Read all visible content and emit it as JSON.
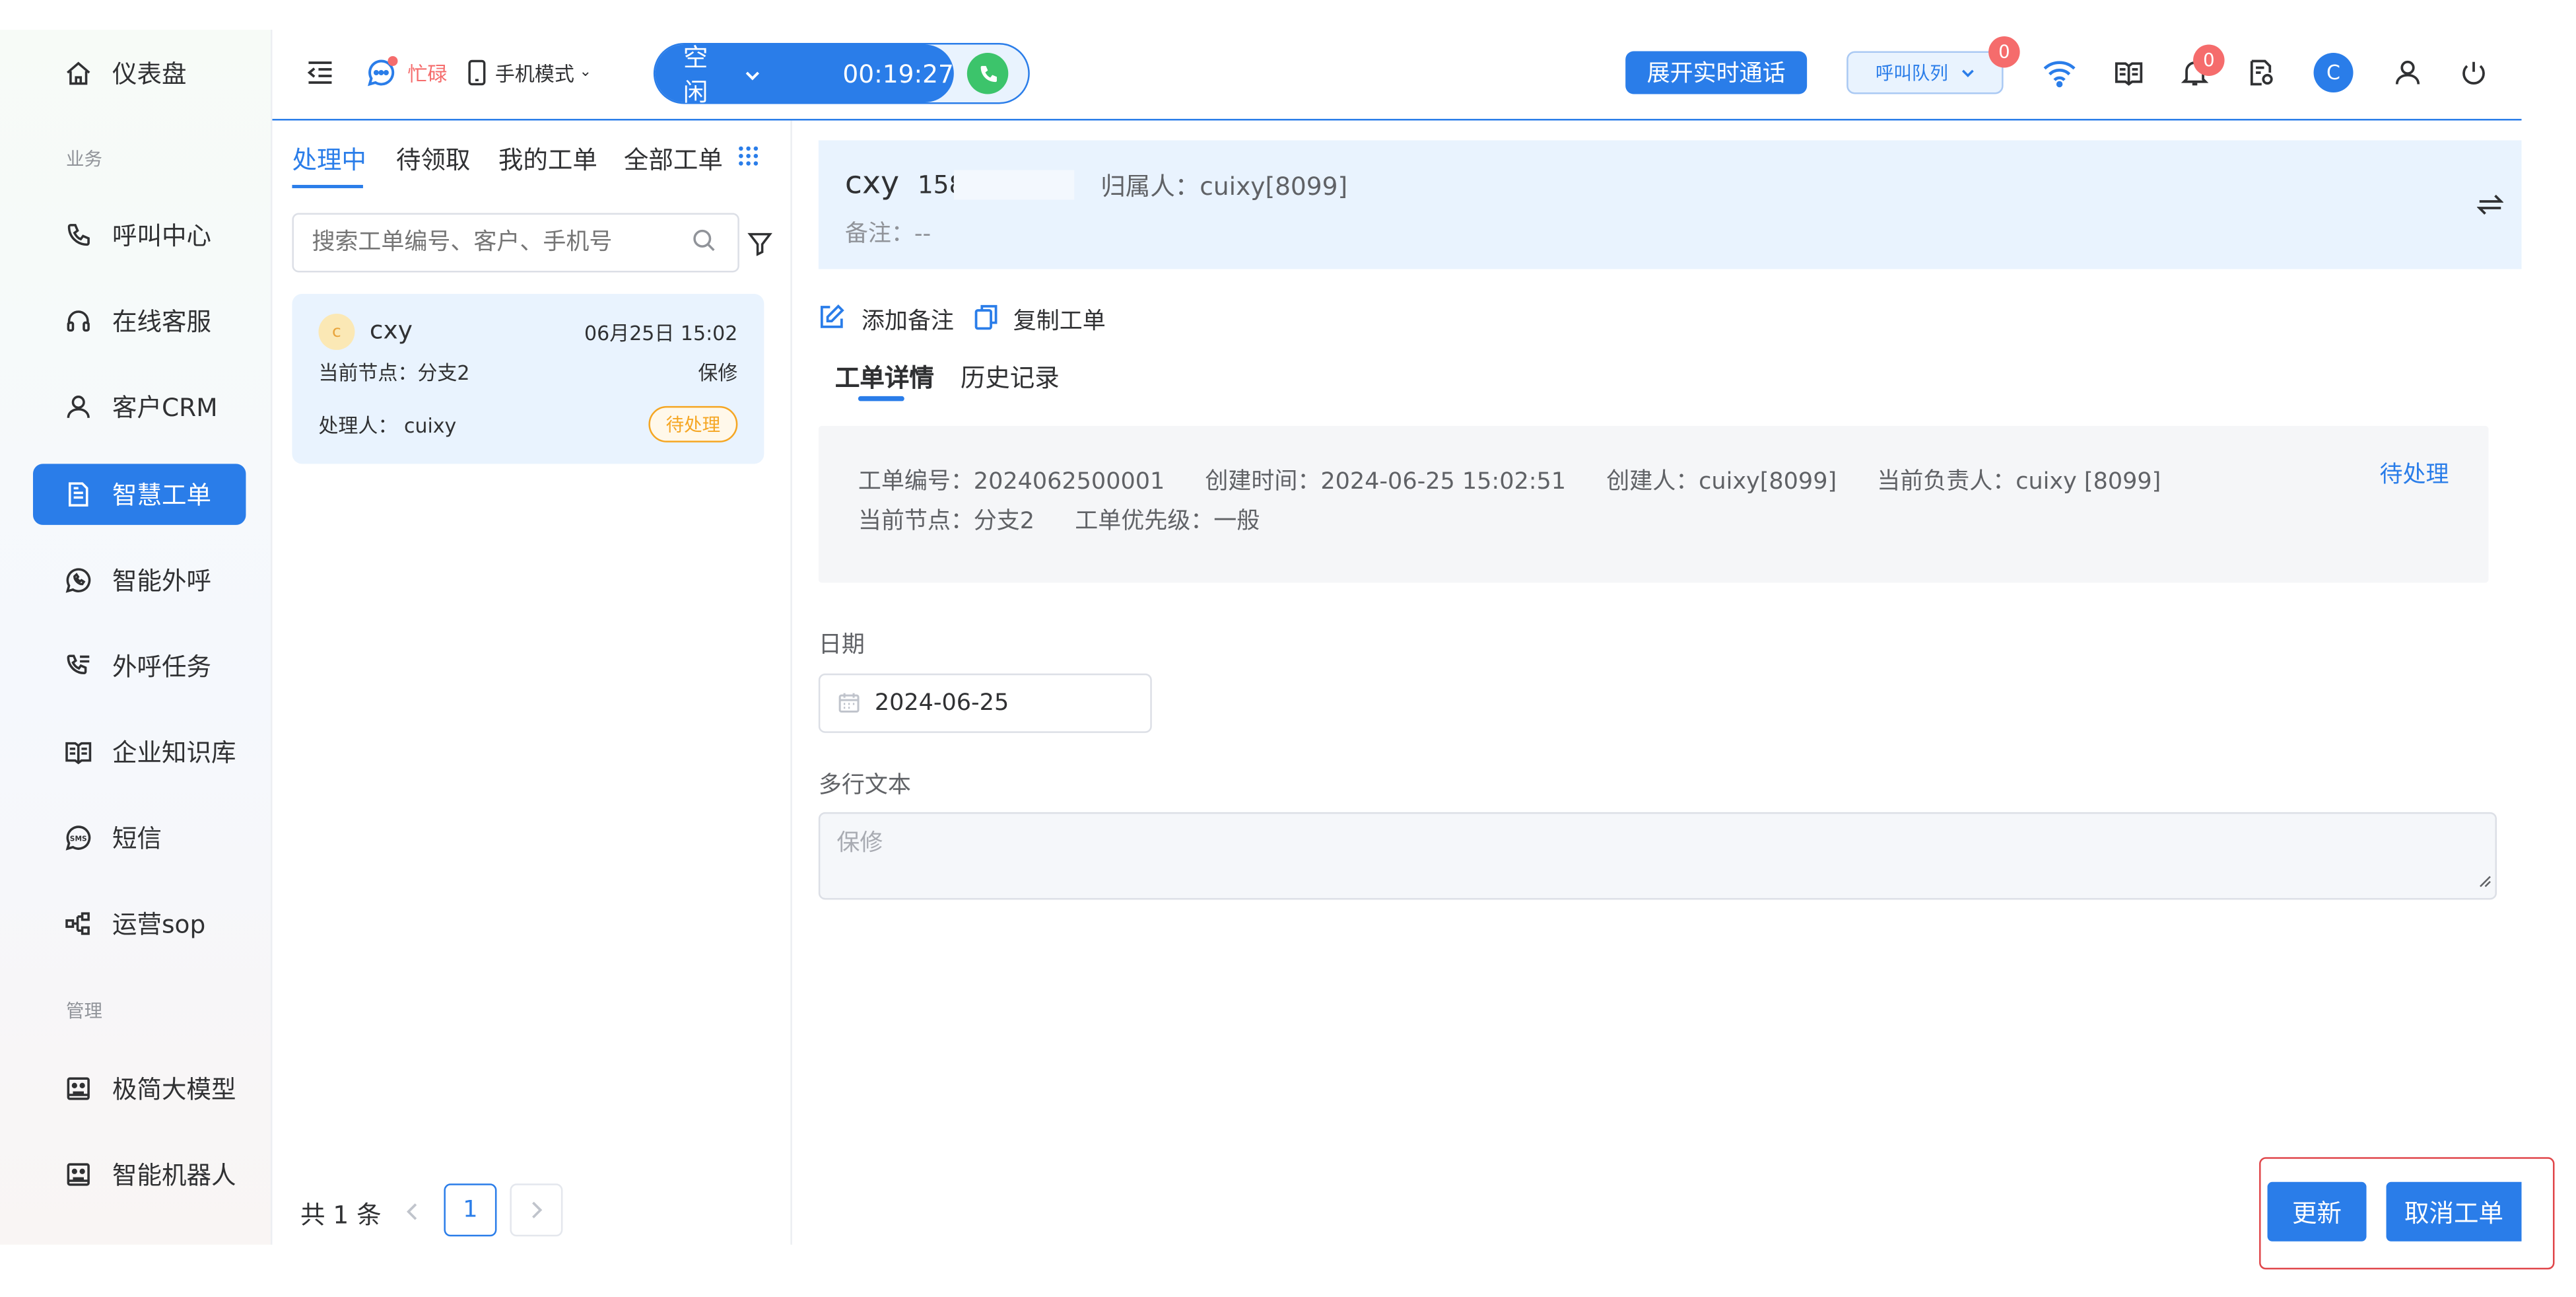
{
  "sidebar": {
    "items": [
      {
        "label": "仪表盘",
        "icon": "home-icon"
      },
      {
        "label": "呼叫中心",
        "icon": "phone-icon"
      },
      {
        "label": "在线客服",
        "icon": "headset-icon"
      },
      {
        "label": "客户CRM",
        "icon": "user-icon"
      },
      {
        "label": "智慧工单",
        "icon": "document-icon",
        "active": true
      },
      {
        "label": "智能外呼",
        "icon": "whatsapp-phone-icon"
      },
      {
        "label": "外呼任务",
        "icon": "phone-list-icon"
      },
      {
        "label": "企业知识库",
        "icon": "book-icon"
      },
      {
        "label": "短信",
        "icon": "sms-icon"
      },
      {
        "label": "运营sop",
        "icon": "flow-icon"
      },
      {
        "label": "极简大模型",
        "icon": "robot-icon"
      },
      {
        "label": "智能机器人",
        "icon": "robot-icon"
      }
    ],
    "sections": {
      "business": "业务",
      "management": "管理"
    }
  },
  "topbar": {
    "busy_label": "忙碌",
    "mode_label": "手机模式",
    "status_label": "空闲",
    "timer": "00:19:27",
    "expand_call_label": "展开实时通话",
    "queue_label": "呼叫队列",
    "queue_badge": "0",
    "notify_badge": "0",
    "avatar_letter": "C"
  },
  "list": {
    "tabs": [
      "处理中",
      "待领取",
      "我的工单",
      "全部工单"
    ],
    "search_placeholder": "搜索工单编号、客户、手机号",
    "card": {
      "avatar": "c",
      "name": "cxy",
      "time": "06月25日 15:02",
      "node": "当前节点：分支2",
      "type": "保修",
      "handler": "处理人： cuixy",
      "status": "待处理"
    },
    "total": "共 1 条",
    "page": "1"
  },
  "detail": {
    "customer_name": "cxy",
    "phone": "158",
    "owner": "归属人：cuixy[8099]",
    "remark": "备注：--",
    "add_remark": "添加备注",
    "copy_order": "复制工单",
    "tabs": [
      "工单详情",
      "历史记录"
    ],
    "info": {
      "order_no": "工单编号：2024062500001",
      "created_time": "创建时间：2024-06-25 15:02:51",
      "creator": "创建人：cuixy[8099]",
      "assignee": "当前负责人：cuixy [8099]",
      "node": "当前节点：分支2",
      "priority": "工单优先级：一般",
      "status": "待处理"
    },
    "date_label": "日期",
    "date_value": "2024-06-25",
    "text_label": "多行文本",
    "text_value": "保修",
    "update_label": "更新",
    "cancel_label": "取消工单"
  },
  "colors": {
    "accent": "#2a7de9",
    "highlight_border": "#e0474b",
    "status_orange": "#f5a623",
    "busy_red": "#f56c6c",
    "call_green": "#3cc46b"
  }
}
